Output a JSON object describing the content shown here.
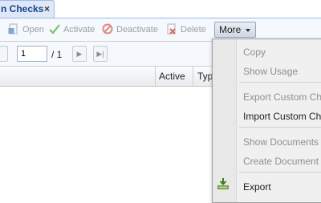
{
  "tab": {
    "title": "n Checks",
    "close_glyph": "×"
  },
  "toolbar": {
    "open_label": "Open",
    "activate_label": "Activate",
    "deactivate_label": "Deactivate",
    "delete_label": "Delete",
    "more_label": "More"
  },
  "pager": {
    "page_value": "1",
    "of_text": "/ 1"
  },
  "grid": {
    "columns": [
      "Active",
      "Typ"
    ]
  },
  "menu": {
    "items": [
      {
        "label": "Copy",
        "enabled": false
      },
      {
        "label": "Show Usage",
        "enabled": false
      },
      {
        "label": "Export Custom Che",
        "enabled": false
      },
      {
        "label": "Import Custom Che",
        "enabled": true
      },
      {
        "label": "Show Documents",
        "enabled": false
      },
      {
        "label": "Create Document",
        "enabled": false
      },
      {
        "label": "Export",
        "enabled": true,
        "icon": "export-icon"
      }
    ]
  },
  "colors": {
    "tab_bg": "#dfe8f6",
    "tab_border": "#99bce8",
    "toolbar_bg": "#f5f8fc",
    "menu_bg": "#f0f0f0",
    "disabled_text": "#8f8f8f"
  }
}
